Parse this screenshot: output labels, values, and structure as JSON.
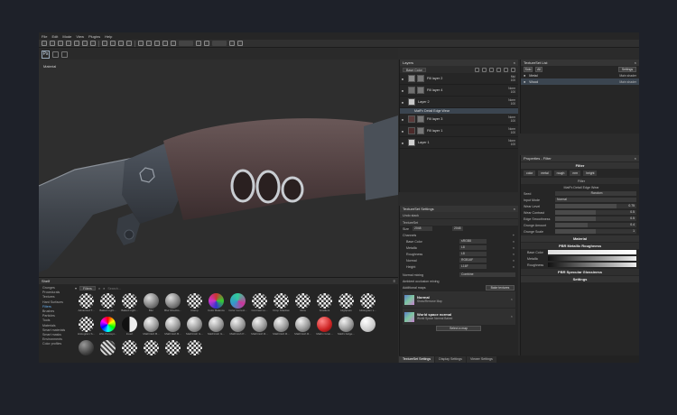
{
  "menu": [
    "File",
    "Edit",
    "Mode",
    "View",
    "Plugins",
    "Help"
  ],
  "viewport": {
    "label": "Material"
  },
  "shelf": {
    "title": "Shelf",
    "search_tab": "Filters",
    "search_placeholder": "Search...",
    "categories": [
      "Grunges",
      "Procedurals",
      "Textures",
      "Hard Surfaces",
      "Filters",
      "Brushes",
      "Particles",
      "Tools",
      "Materials",
      "Smart materials",
      "Smart masks",
      "Environments",
      "Color profiles"
    ],
    "selected_category": "Filters",
    "items": [
      {
        "label": "Advanced T...",
        "style": "checker"
      },
      {
        "label": "Baked Light...",
        "style": "checker"
      },
      {
        "label": "Baked Light...",
        "style": "checker"
      },
      {
        "label": "Blur",
        "style": "grey"
      },
      {
        "label": "Blur Directio...",
        "style": "grey"
      },
      {
        "label": "Clamp",
        "style": "checker"
      },
      {
        "label": "Color Balance",
        "style": "rgb"
      },
      {
        "label": "Color Correct...",
        "style": "rgb2"
      },
      {
        "label": "Contrast Lu...",
        "style": "checker"
      },
      {
        "label": "Drop Shadow",
        "style": "checker"
      },
      {
        "label": "Glow",
        "style": "checker"
      },
      {
        "label": "Gradient",
        "style": "checker"
      },
      {
        "label": "Highpass",
        "style": "checker"
      },
      {
        "label": "Histogram s...",
        "style": "checker"
      },
      {
        "label": "Histogram S...",
        "style": "checker"
      },
      {
        "label": "HSL Percept...",
        "style": "hsl"
      },
      {
        "label": "Invert",
        "style": "half"
      },
      {
        "label": "MatFinish B...",
        "style": "metal"
      },
      {
        "label": "MatFinish B...",
        "style": "metal"
      },
      {
        "label": "MatFinish G...",
        "style": "metal"
      },
      {
        "label": "MatFinish G...",
        "style": "metal"
      },
      {
        "label": "MatFinish P...",
        "style": "metal"
      },
      {
        "label": "MatFinish R...",
        "style": "metal"
      },
      {
        "label": "MatFinish R...",
        "style": "metal"
      },
      {
        "label": "MatFinish R...",
        "style": "metal"
      },
      {
        "label": "MatFx Grun...",
        "style": "red"
      },
      {
        "label": "MatFx Edge...",
        "style": "metal"
      },
      {
        "label": "",
        "style": "white"
      },
      {
        "label": "",
        "style": "dark"
      },
      {
        "label": "",
        "style": "stripe"
      },
      {
        "label": "",
        "style": "checker"
      },
      {
        "label": "",
        "style": "checker"
      },
      {
        "label": "",
        "style": "checker"
      },
      {
        "label": "",
        "style": "checker"
      }
    ]
  },
  "layers": {
    "title": "Layers",
    "blend_dropdown": "Base Color",
    "items": [
      {
        "name": "Fill layer 2",
        "blend": "Mul",
        "opacity": "100",
        "thumb": "#8a8a8a"
      },
      {
        "name": "Fill layer 4",
        "blend": "Norm",
        "opacity": "100",
        "thumb": "#6f6f6f"
      },
      {
        "name": "Layer 2",
        "blend": "Norm",
        "opacity": "100",
        "thumb": "#c8c8c8"
      },
      {
        "name": "Fill layer 3",
        "blend": "Norm",
        "opacity": "100",
        "thumb": "#5a3a3a"
      },
      {
        "name": "Fill layer 1",
        "blend": "Norm",
        "opacity": "100",
        "thumb": "#4b2a2a"
      },
      {
        "name": "Layer 1",
        "blend": "Norm",
        "opacity": "100",
        "thumb": "#d0d0d0"
      }
    ],
    "filter_row": "MatFx Detail Edge Wear"
  },
  "textureset_settings": {
    "title": "TextureSet Settings",
    "undo": "Undo stack",
    "textureset_label": "TextureSet",
    "size_label": "Size",
    "size_value": "2048",
    "size_value2": "2048",
    "channels_label": "Channels",
    "channels": [
      {
        "name": "Base Color",
        "fmt": "sRGB8"
      },
      {
        "name": "Metallic",
        "fmt": "L8"
      },
      {
        "name": "Roughness",
        "fmt": "L8"
      },
      {
        "name": "Normal",
        "fmt": "RGB16F"
      },
      {
        "name": "Height",
        "fmt": "L16F"
      }
    ],
    "normal_mixing_label": "Normal mixing",
    "normal_mixing_value": "Combine",
    "ao_mixing_label": "Ambient occlusion mixing",
    "additional_maps_label": "Additional maps",
    "bake_button": "Bake textures",
    "maps": [
      {
        "title": "Normal",
        "sub": "Show/Remove Map"
      },
      {
        "title": "World space normal",
        "sub": "World Space Normal Baked"
      }
    ],
    "select_map": "Select a map"
  },
  "bottom_tabs": [
    "TextureSet Settings",
    "Display Settings",
    "Viewer Settings"
  ],
  "textureset_list": {
    "title": "TextureSet List",
    "solo": "Solo",
    "all": "All",
    "settings_button": "Settings",
    "items": [
      {
        "name": "Metal",
        "shader": "Main shader"
      },
      {
        "name": "Wood",
        "shader": "Main shader"
      }
    ]
  },
  "properties": {
    "title": "Properties - Filter",
    "filter_section": "Filter",
    "chips": [
      "color",
      "metal",
      "rough",
      "nrm",
      "height"
    ],
    "filter_sub": "Filter",
    "filter_name": "MatFx Detail Edge Wear",
    "seed_label": "Seed",
    "seed_value": "Random",
    "input_mode_label": "Input Mode",
    "input_mode_value": "Normal",
    "sliders": [
      {
        "label": "Wear Level",
        "value": "0.75",
        "frac": 0.75
      },
      {
        "label": "Wear Contrast",
        "value": "0.5",
        "frac": 0.5
      },
      {
        "label": "Edge Smoothness",
        "value": "0.5",
        "frac": 0.5
      },
      {
        "label": "Grunge Amount",
        "value": "0.4",
        "frac": 0.4
      },
      {
        "label": "Grunge Scale",
        "value": "1",
        "frac": 0.5
      }
    ],
    "material_section": "Material",
    "pbr_metal": "PBR Metallic Roughness",
    "base_color_label": "Base Color",
    "metallic_label": "Metallic",
    "roughness_label": "Roughness",
    "pbr_spec": "PBR Specular Glossiness",
    "settings_section": "Settings"
  }
}
